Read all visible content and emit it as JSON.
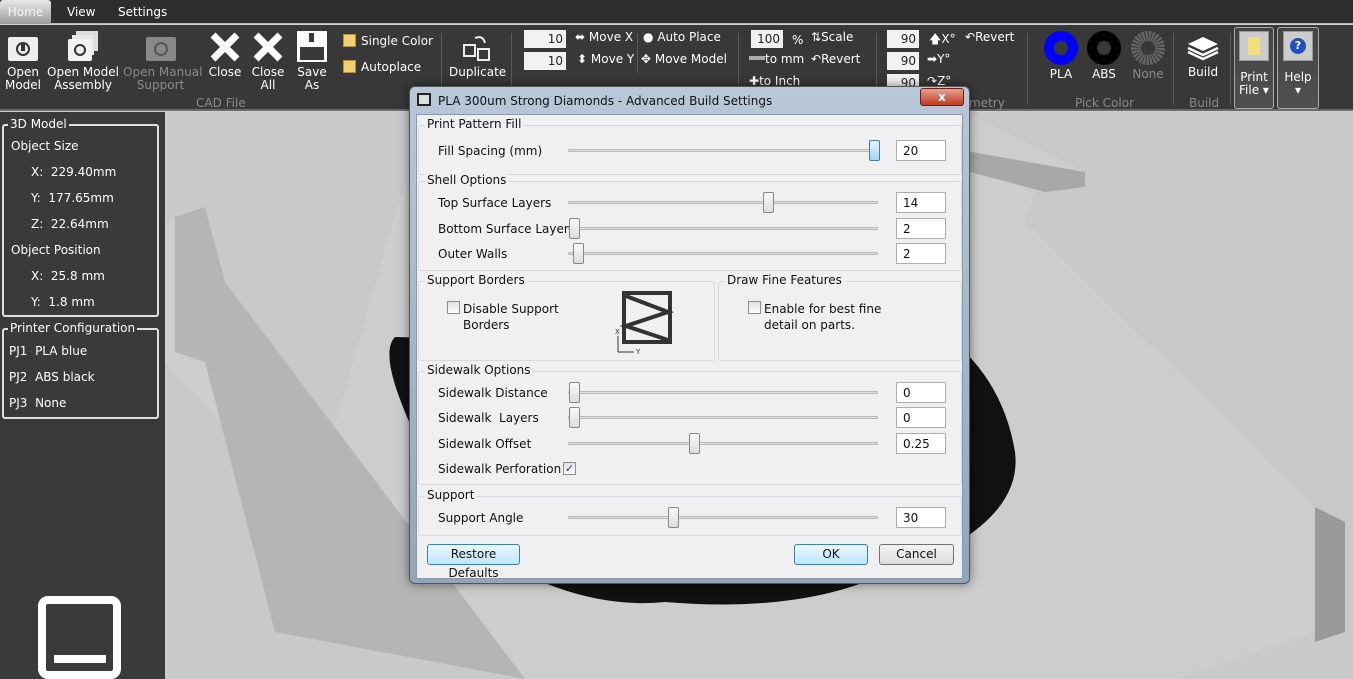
{
  "tabs": [
    "Home",
    "View",
    "Settings"
  ],
  "ribbon": {
    "cad_file": {
      "group": "CAD File",
      "open_model": "Open\nModel",
      "open_assembly": "Open Model\nAssembly",
      "open_manual_support": "Open Manual\nSupport",
      "close": "Close",
      "close_all": "Close\nAll",
      "save_as": "Save\nAs",
      "single_color": "Single Color",
      "autoplace": "Autoplace",
      "single_color_checked": true,
      "autoplace_checked": true
    },
    "duplicate": "Duplicate",
    "move": {
      "x_value": "10",
      "y_value": "10",
      "move_x": "Move X",
      "move_y": "Move Y",
      "auto_place": "Auto Place",
      "move_model": "Move Model"
    },
    "scale": {
      "value": "100",
      "unit": "%",
      "scale": "Scale",
      "to_mm": "to mm",
      "revert": "Revert",
      "to_inch": "to Inch"
    },
    "rotate": {
      "x_value": "90",
      "y_value": "90",
      "z_value": "90",
      "x": "X°",
      "y": "Y°",
      "z": "Z°",
      "revert": "Revert",
      "group": "Geometry"
    },
    "pick_color": {
      "group": "Pick Color",
      "pla": "PLA",
      "abs": "ABS",
      "none": "None",
      "pla_color": "#0000ff",
      "abs_color": "#000000"
    },
    "build": {
      "label": "Build",
      "group": "Build"
    },
    "print_file": "Print\nFile ▾",
    "help": "Help\n▾"
  },
  "model_panel": {
    "title": "3D Model",
    "size_label": "Object Size",
    "size": [
      {
        "axis": "X:",
        "value": "229.40mm"
      },
      {
        "axis": "Y:",
        "value": "177.65mm"
      },
      {
        "axis": "Z:",
        "value": "22.64mm"
      }
    ],
    "position_label": "Object Position",
    "position": [
      {
        "axis": "X:",
        "value": "25.8 mm"
      },
      {
        "axis": "Y:",
        "value": "1.8 mm"
      }
    ]
  },
  "printer_panel": {
    "title": "Printer Configuration",
    "items": [
      {
        "id": "PJ1",
        "value": "PLA blue"
      },
      {
        "id": "PJ2",
        "value": "ABS black"
      },
      {
        "id": "PJ3",
        "value": "None"
      }
    ]
  },
  "dialog": {
    "title": "PLA 300um Strong Diamonds - Advanced Build Settings",
    "close": "x",
    "print_pattern": {
      "title": "Print Pattern Fill",
      "fill_spacing": {
        "label": "Fill Spacing (mm)",
        "value": "20",
        "level": 1.0
      }
    },
    "shell": {
      "title": "Shell Options",
      "top": {
        "label": "Top Surface Layers",
        "value": "14",
        "level": 0.645
      },
      "bottom": {
        "label": "Bottom Surface Layers",
        "value": "2",
        "level": 0.0
      },
      "outer": {
        "label": "Outer Walls",
        "value": "2",
        "level": 0.012
      }
    },
    "support_borders": {
      "title": "Support Borders",
      "disable": "Disable Support\nBorders",
      "checked": false,
      "axis_x": "X",
      "axis_y": "Y"
    },
    "fine_features": {
      "title": "Draw Fine Features",
      "enable": "Enable for best fine\ndetail on parts.",
      "checked": false
    },
    "sidewalk": {
      "title": "Sidewalk Options",
      "distance": {
        "label": "Sidewalk Distance",
        "value": "0",
        "level": 0.0
      },
      "layers": {
        "label": "Sidewalk  Layers",
        "value": "0",
        "level": 0.0
      },
      "offset": {
        "label": "Sidewalk Offset",
        "value": "0.25",
        "level": 0.4
      },
      "perforation": {
        "label": "Sidewalk Perforation",
        "checked": true
      }
    },
    "support": {
      "title": "Support",
      "angle": {
        "label": "Support Angle",
        "value": "30",
        "level": 0.33
      }
    },
    "restore": "Restore Defaults",
    "ok": "OK",
    "cancel": "Cancel"
  }
}
